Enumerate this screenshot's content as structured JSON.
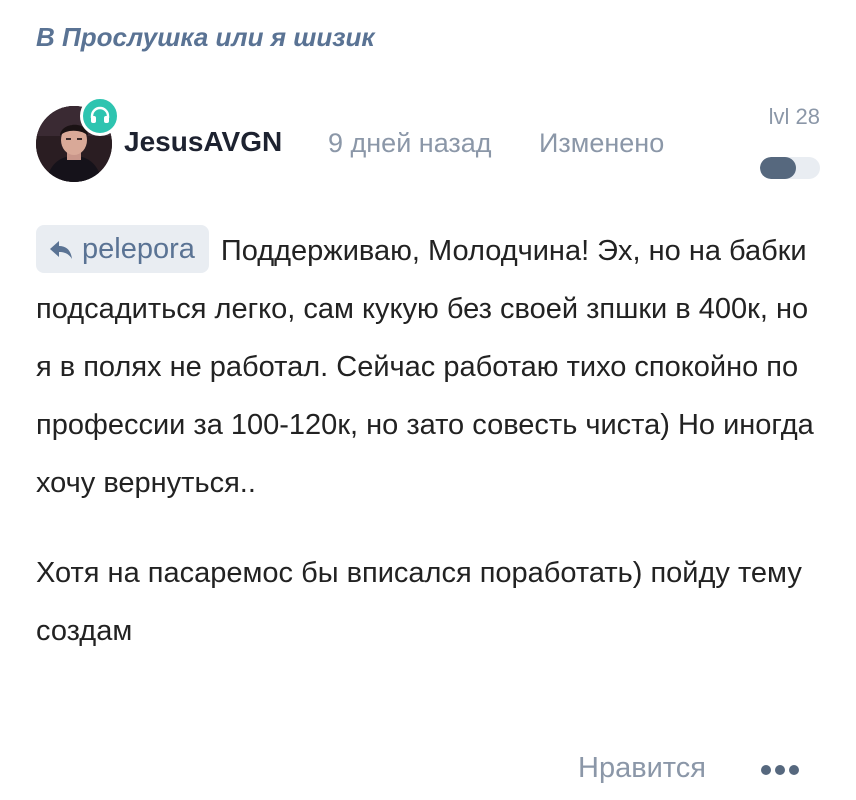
{
  "thread": {
    "prefix": "В",
    "title": "Прослушка или я шизик"
  },
  "post": {
    "author": "JesusAVGN",
    "avatar_icon": "user-avatar",
    "badge_icon": "headset-icon",
    "badge_color": "#2ec4b0",
    "time": "9 дней назад",
    "edited": "Изменено",
    "level": "lvl 28",
    "level_progress": 0.6,
    "quote_icon": "reply-arrow-icon",
    "quote_author": "pelepora",
    "paragraphs": [
      "Поддерживаю, Молодчина! Эх, но на бабки подсадиться легко, сам кукую без своей зпшки в 400к, но я в полях не работал. Сейчас работаю тихо спокойно по профессии за 100-120к, но зато совесть чиста) Но иногда хочу вернуться..",
      "Хотя на пасаремос бы вписался поработать) пойду тему создам"
    ],
    "like_label": "Нравится",
    "more_icon": "more-dots-icon"
  },
  "colors": {
    "accent": "#5a7394",
    "muted": "#8b97a8",
    "text": "#222222",
    "chip_bg": "#e9edf2",
    "level_fill": "#56687e"
  }
}
